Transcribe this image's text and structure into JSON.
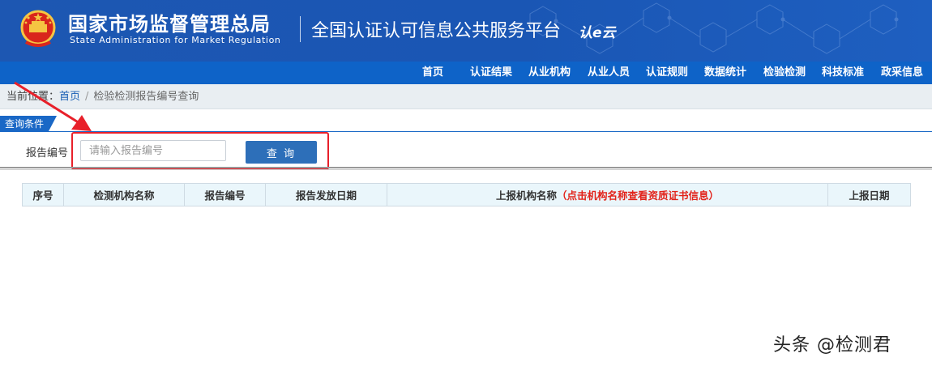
{
  "header": {
    "org_name_cn": "国家市场监督管理总局",
    "org_name_en": "State Administration  for  Market Regulation",
    "platform_title": "全国认证认可信息公共服务平台",
    "brand_logo": "认e云",
    "emblem_icon": "national-emblem-icon",
    "bg_color": "#1b56b0"
  },
  "nav": {
    "items": [
      "首页",
      "认证结果",
      "从业机构",
      "从业人员",
      "认证规则",
      "数据统计",
      "检验检测",
      "科技标准",
      "政采信息"
    ]
  },
  "breadcrumb": {
    "prefix": "当前位置：",
    "home": "首页",
    "separator": "/",
    "current": "检验检测报告编号查询"
  },
  "query": {
    "section_title": "查询条件",
    "field_label": "报告编号",
    "input_placeholder": "请输入报告编号",
    "input_value": "",
    "button_label": "查 询"
  },
  "table": {
    "columns": [
      "序号",
      "检测机构名称",
      "报告编号",
      "报告发放日期",
      "上报机构名称",
      "上报日期"
    ],
    "column_note": "（点击机构名称查看资质证书信息）",
    "rows": []
  },
  "annotation": {
    "highlight_color": "#e8202a"
  },
  "watermark": "头条 @检测君"
}
